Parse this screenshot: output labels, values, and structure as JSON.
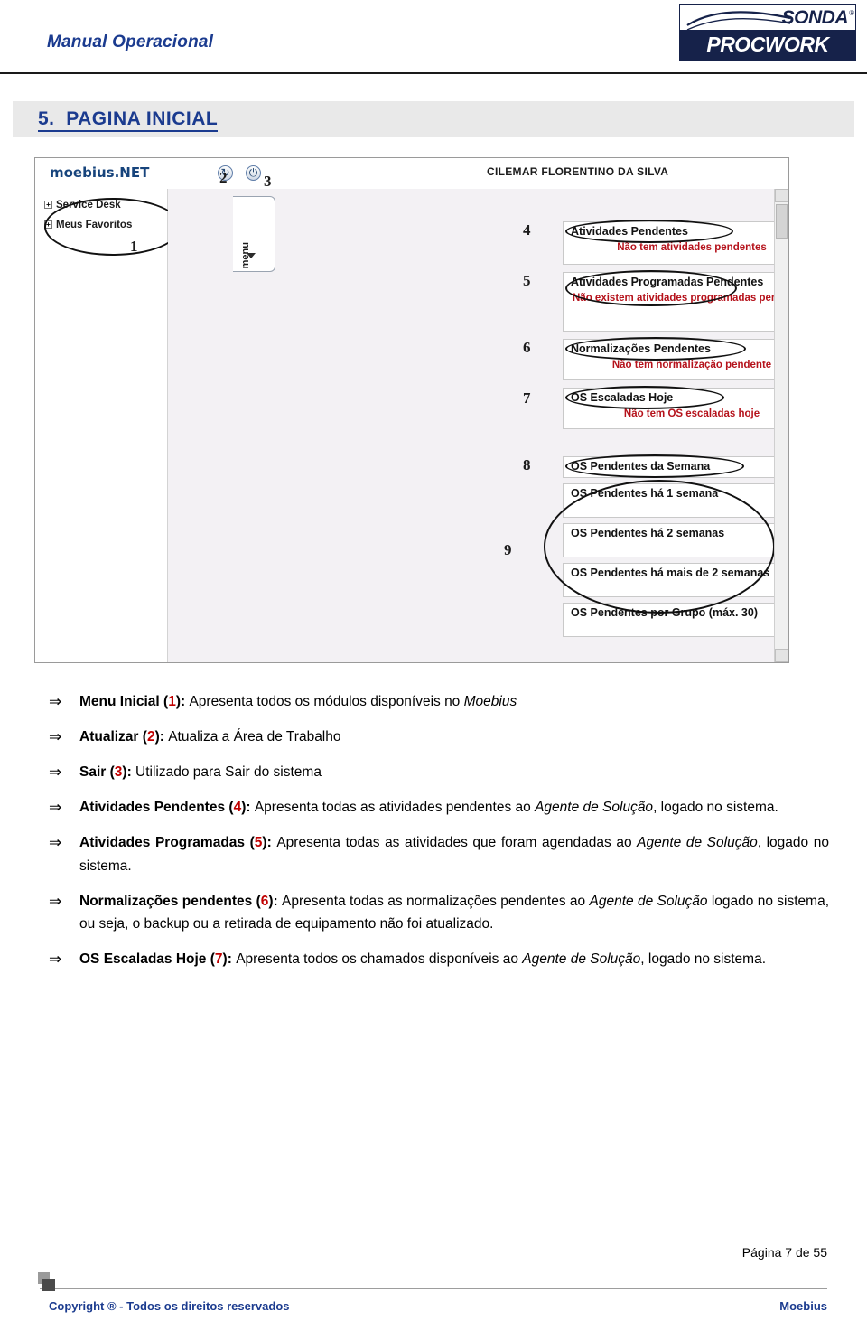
{
  "header": {
    "title": "Manual Operacional",
    "logo": {
      "brand_top": "SONDA",
      "registered": "®",
      "brand_bottom": "PROCWORK"
    }
  },
  "section": {
    "number": "5.",
    "title": "PAGINA INICIAL"
  },
  "figure": {
    "app_brand": "moebius.NET",
    "user_name": "CILEMAR FLORENTINO DA SILVA",
    "menu_tab_label": "menu",
    "tree_items": [
      {
        "label": "Service Desk",
        "expander": "+"
      },
      {
        "label": "Meus Favoritos",
        "expander": "+"
      }
    ],
    "callouts": [
      "1",
      "2",
      "3",
      "4",
      "5",
      "6",
      "7",
      "8",
      "9"
    ],
    "panels": [
      {
        "title": "Atividades Pendentes",
        "message": "Não tem atividades pendentes"
      },
      {
        "title": "Atividades Programadas Pendentes",
        "message": "Não existem atividades programadas pendentes"
      },
      {
        "title": "Normalizações Pendentes",
        "message": "Não tem normalização pendente"
      },
      {
        "title": "OS Escaladas Hoje",
        "message": "Não tem OS escaladas hoje"
      },
      {
        "title": "OS Pendentes da Semana",
        "message": ""
      },
      {
        "title": "OS Pendentes há 1 semana",
        "message": ""
      },
      {
        "title": "OS Pendentes há 2 semanas",
        "message": ""
      },
      {
        "title": "OS Pendentes há mais de 2 semanas",
        "message": ""
      },
      {
        "title": "OS Pendentes por Grupo (máx. 30)",
        "message": ""
      }
    ]
  },
  "bullets": [
    {
      "arrow": "⇒",
      "segments": [
        {
          "text": "Menu Inicial ",
          "style": "bold"
        },
        {
          "text": "(",
          "style": "bold"
        },
        {
          "text": "1",
          "style": "num"
        },
        {
          "text": "): ",
          "style": "bold"
        },
        {
          "text": "Apresenta todos os módulos disponíveis no ",
          "style": "plain"
        },
        {
          "text": "Moebius",
          "style": "italic"
        }
      ]
    },
    {
      "arrow": "⇒",
      "segments": [
        {
          "text": "Atualizar ",
          "style": "bold"
        },
        {
          "text": "(",
          "style": "bold"
        },
        {
          "text": "2",
          "style": "num"
        },
        {
          "text": "): ",
          "style": "bold"
        },
        {
          "text": "Atualiza a Área de Trabalho",
          "style": "plain"
        }
      ]
    },
    {
      "arrow": "⇒",
      "segments": [
        {
          "text": "Sair ",
          "style": "bold"
        },
        {
          "text": "(",
          "style": "bold"
        },
        {
          "text": "3",
          "style": "num"
        },
        {
          "text": "): ",
          "style": "bold"
        },
        {
          "text": "Utilizado para Sair do sistema",
          "style": "plain"
        }
      ]
    },
    {
      "arrow": "⇒",
      "segments": [
        {
          "text": "Atividades Pendentes ",
          "style": "bold"
        },
        {
          "text": "(",
          "style": "bold"
        },
        {
          "text": "4",
          "style": "num"
        },
        {
          "text": "): ",
          "style": "bold"
        },
        {
          "text": "Apresenta todas as atividades pendentes ao ",
          "style": "plain"
        },
        {
          "text": "Agente de Solução",
          "style": "italic"
        },
        {
          "text": ", logado no sistema.",
          "style": "plain"
        }
      ]
    },
    {
      "arrow": "⇒",
      "segments": [
        {
          "text": "Atividades Programadas ",
          "style": "bold"
        },
        {
          "text": "(",
          "style": "bold"
        },
        {
          "text": "5",
          "style": "num"
        },
        {
          "text": "): ",
          "style": "bold"
        },
        {
          "text": "Apresenta todas as atividades que foram agendadas ao ",
          "style": "plain"
        },
        {
          "text": "Agente de Solução",
          "style": "italic"
        },
        {
          "text": ", logado no sistema.",
          "style": "plain"
        }
      ]
    },
    {
      "arrow": "⇒",
      "segments": [
        {
          "text": "Normalizações pendentes ",
          "style": "bold"
        },
        {
          "text": "(",
          "style": "bold"
        },
        {
          "text": "6",
          "style": "num"
        },
        {
          "text": "): ",
          "style": "bold"
        },
        {
          "text": "Apresenta todas as normalizações pendentes ao ",
          "style": "plain"
        },
        {
          "text": "Agente de Solução",
          "style": "italic"
        },
        {
          "text": " logado no sistema, ou seja, o backup ou a retirada de equipamento não foi atualizado.",
          "style": "plain"
        }
      ]
    },
    {
      "arrow": "⇒",
      "segments": [
        {
          "text": "OS Escaladas Hoje ",
          "style": "bold"
        },
        {
          "text": "(",
          "style": "bold"
        },
        {
          "text": "7",
          "style": "num"
        },
        {
          "text": "): ",
          "style": "bold"
        },
        {
          "text": "Apresenta todos os chamados disponíveis ao ",
          "style": "plain"
        },
        {
          "text": "Agente de Solução",
          "style": "italic"
        },
        {
          "text": ", logado no sistema.",
          "style": "plain"
        }
      ]
    }
  ],
  "footer": {
    "page_number": "Página 7 de 55",
    "copyright": "Copyright ® - Todos os direitos reservados",
    "product": "Moebius"
  }
}
